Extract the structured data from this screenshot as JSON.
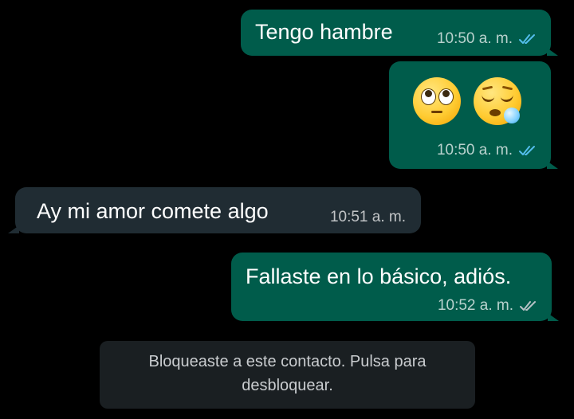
{
  "colors": {
    "background": "#000000",
    "outgoing_bubble": "#005c4b",
    "incoming_bubble": "#202c33",
    "read_check": "#53bdeb",
    "delivered_check": "#b8c2c7"
  },
  "messages": [
    {
      "direction": "outgoing",
      "text": "Tengo hambre",
      "time": "10:50 a. m.",
      "status": "read",
      "status_icon": "double-check-icon"
    },
    {
      "direction": "outgoing",
      "emojis": [
        "face-with-rolling-eyes",
        "sleepy-face"
      ],
      "time": "10:50 a. m.",
      "status": "read",
      "status_icon": "double-check-icon"
    },
    {
      "direction": "incoming",
      "text": "Ay mi amor comete algo",
      "time": "10:51 a. m."
    },
    {
      "direction": "outgoing",
      "text": "Fallaste en lo básico, adiós.",
      "time": "10:52 a. m.",
      "status": "delivered",
      "status_icon": "double-check-icon"
    }
  ],
  "system_notice": {
    "line1": "Bloqueaste a este contacto. Pulsa para",
    "line2": "desbloquear."
  }
}
